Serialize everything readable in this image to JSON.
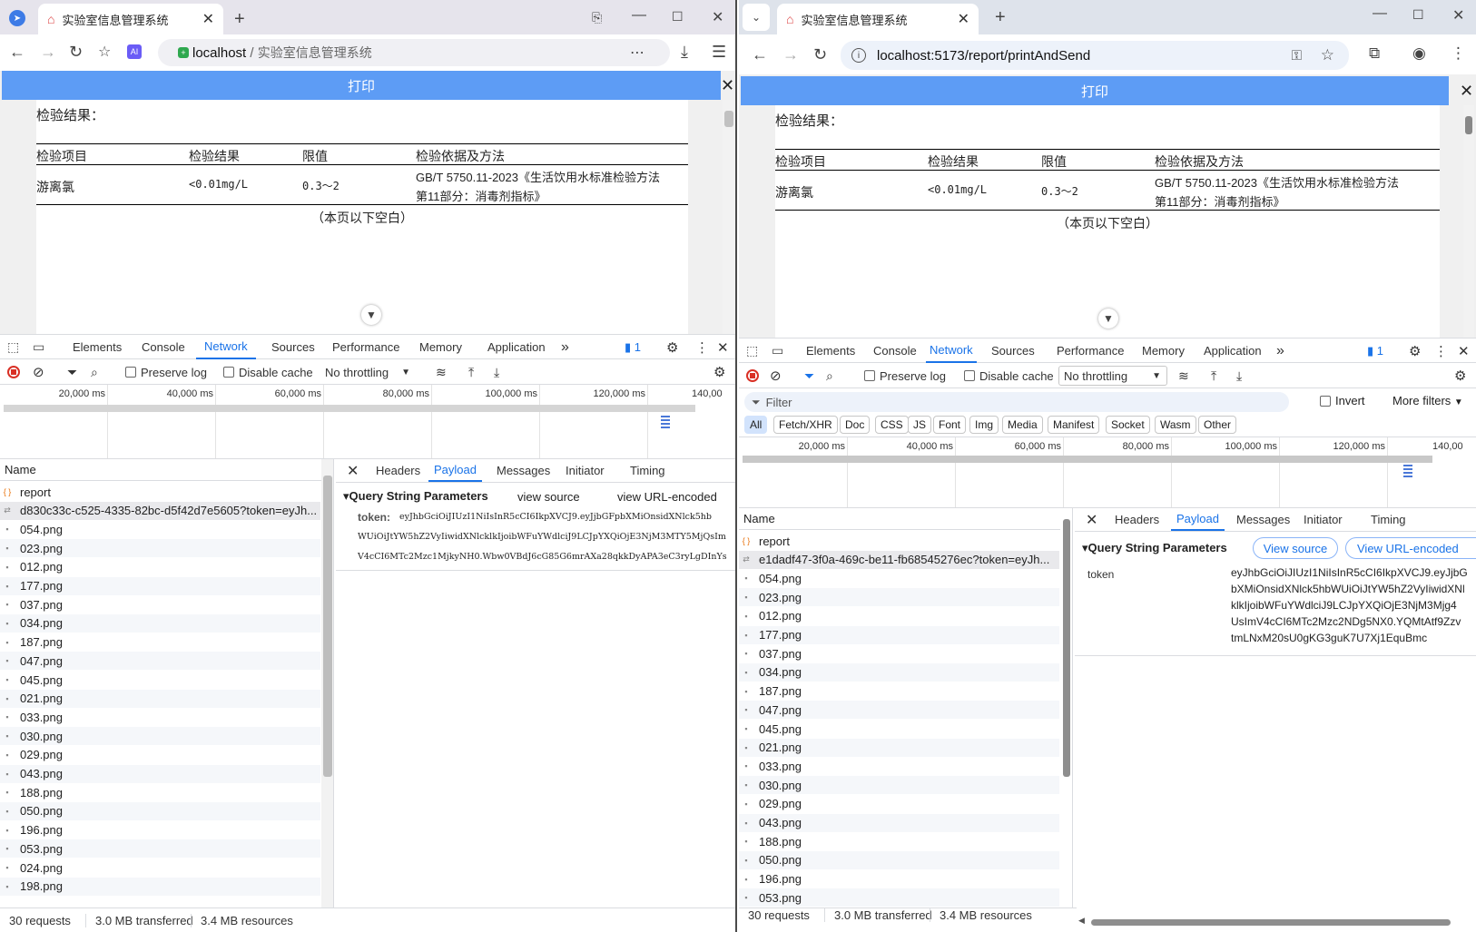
{
  "left": {
    "tab_title": "实验室信息管理系统",
    "address_host": "localhost",
    "address_sep": " / ",
    "address_title": "实验室信息管理系统",
    "print_label": "打印",
    "report": {
      "result_heading": "检验结果：",
      "headers": [
        "检验项目",
        "检验结果",
        "限值",
        "检验依据及方法"
      ],
      "item": "游离氯",
      "result": "<0.01mg/L",
      "limit": "0.3～2",
      "method_line1": "GB/T 5750.11-2023《生活饮用水标准检验方法",
      "method_line2": "第11部分：消毒剂指标》",
      "blank_note": "（本页以下空白）"
    },
    "devtools_tabs": [
      "Elements",
      "Console",
      "Network",
      "Sources",
      "Performance",
      "Memory",
      "Application"
    ],
    "issues_count": "1",
    "toolbar": {
      "preserve_log": "Preserve log",
      "disable_cache": "Disable cache",
      "throttling": "No throttling"
    },
    "timeline_ticks": [
      "20,000 ms",
      "40,000 ms",
      "60,000 ms",
      "80,000 ms",
      "100,000 ms",
      "120,000 ms",
      "140,00"
    ],
    "name_header": "Name",
    "requests": [
      "report",
      "d830c33c-c525-4335-82bc-d5f42d7e5605?token=eyJh...",
      "054.png",
      "023.png",
      "012.png",
      "177.png",
      "037.png",
      "034.png",
      "187.png",
      "047.png",
      "045.png",
      "021.png",
      "033.png",
      "030.png",
      "029.png",
      "043.png",
      "188.png",
      "050.png",
      "196.png",
      "053.png",
      "024.png",
      "198.png"
    ],
    "detail_tabs": [
      "Headers",
      "Payload",
      "Messages",
      "Initiator",
      "Timing"
    ],
    "qsp_title": "Query String Parameters",
    "view_source": "view source",
    "view_url_encoded": "view URL-encoded",
    "token_key": "token:",
    "token_lines": [
      "eyJhbGciOiJIUzI1NiIsInR5cCI6IkpXVCJ9.eyJjbGFpbXMiOnsidXNlck5hb",
      "WUiOiJtYW5hZ2VyIiwidXNlcklkIjoibWFuYWdlciJ9LCJpYXQiOjE3NjM3MTY5MjQsIm",
      "V4cCI6MTc2Mzc1MjkyNH0.Wbw0VBdJ6cG85G6mrAXa28qkkDyAPA3eC3ryLgDInYs"
    ],
    "status": {
      "requests": "30 requests",
      "transferred": "3.0 MB transferred",
      "resources": "3.4 MB resources"
    }
  },
  "right": {
    "tab_title": "实验室信息管理系统",
    "address": "localhost:5173/report/printAndSend",
    "print_label": "打印",
    "report": {
      "result_heading": "检验结果：",
      "headers": [
        "检验项目",
        "检验结果",
        "限值",
        "检验依据及方法"
      ],
      "item": "游离氯",
      "result": "<0.01mg/L",
      "limit": "0.3～2",
      "method_line1": "GB/T 5750.11-2023《生活饮用水标准检验方法",
      "method_line2": "第11部分：消毒剂指标》",
      "blank_note": "（本页以下空白）"
    },
    "devtools_tabs": [
      "Elements",
      "Console",
      "Network",
      "Sources",
      "Performance",
      "Memory",
      "Application"
    ],
    "issues_count": "1",
    "toolbar": {
      "preserve_log": "Preserve log",
      "disable_cache": "Disable cache",
      "throttling": "No throttling"
    },
    "filter_placeholder": "Filter",
    "invert": "Invert",
    "more_filters": "More filters",
    "type_filters": [
      "All",
      "Fetch/XHR",
      "Doc",
      "CSS",
      "JS",
      "Font",
      "Img",
      "Media",
      "Manifest",
      "Socket",
      "Wasm",
      "Other"
    ],
    "timeline_ticks": [
      "20,000 ms",
      "40,000 ms",
      "60,000 ms",
      "80,000 ms",
      "100,000 ms",
      "120,000 ms",
      "140,00"
    ],
    "name_header": "Name",
    "requests": [
      "report",
      "e1dadf47-3f0a-469c-be11-fb68545276ec?token=eyJh...",
      "054.png",
      "023.png",
      "012.png",
      "177.png",
      "037.png",
      "034.png",
      "187.png",
      "047.png",
      "045.png",
      "021.png",
      "033.png",
      "030.png",
      "029.png",
      "043.png",
      "188.png",
      "050.png",
      "196.png",
      "053.png"
    ],
    "detail_tabs": [
      "Headers",
      "Payload",
      "Messages",
      "Initiator",
      "Timing"
    ],
    "qsp_title": "Query String Parameters",
    "view_source": "View source",
    "view_url_encoded": "View URL-encoded",
    "token_key": "token",
    "token_lines": [
      "eyJhbGciOiJIUzI1NiIsInR5cCI6IkpXVCJ9.eyJjbG",
      "bXMiOnsidXNlck5hbWUiOiJtYW5hZ2VyIiwidXNl",
      "klkIjoibWFuYWdlciJ9LCJpYXQiOjE3NjM3Mjg4",
      "UsImV4cCI6MTc2Mzc2NDg5NX0.YQMtAtf9Zzv",
      "tmLNxM20sU0gKG3guK7U7Xj1EquBmc"
    ],
    "status": {
      "requests": "30 requests",
      "transferred": "3.0 MB transferred",
      "resources": "3.4 MB resources"
    }
  },
  "colors": {
    "accent": "#1a73e8",
    "print_bar": "#5d9cf5",
    "record_red": "#d93025"
  }
}
